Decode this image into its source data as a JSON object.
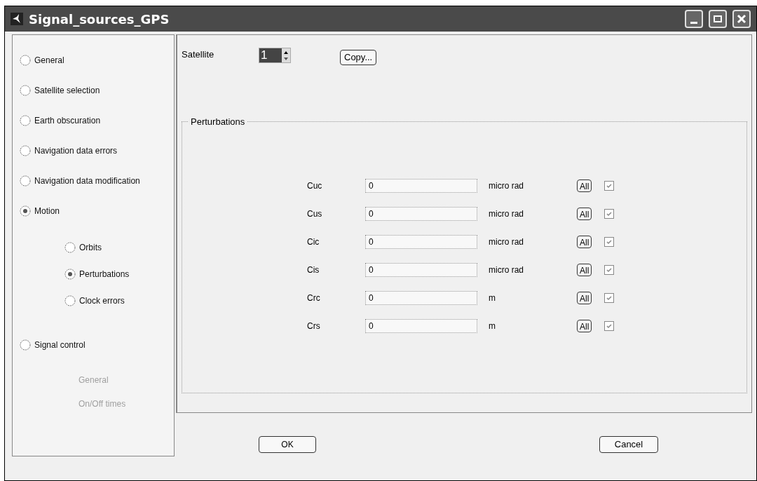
{
  "window": {
    "title": "Signal_sources_GPS"
  },
  "sidebar": {
    "items": [
      {
        "kind": "radio",
        "label": "General",
        "selected": false,
        "disabled": false
      },
      {
        "kind": "radio",
        "label": "Satellite selection",
        "selected": false,
        "disabled": false
      },
      {
        "kind": "radio",
        "label": "Earth obscuration",
        "selected": false,
        "disabled": false
      },
      {
        "kind": "radio",
        "label": "Navigation data errors",
        "selected": false,
        "disabled": false
      },
      {
        "kind": "radio",
        "label": "Navigation data modification",
        "selected": false,
        "disabled": false
      },
      {
        "kind": "radio",
        "label": "Motion",
        "selected": true,
        "disabled": false,
        "children": [
          {
            "kind": "radio",
            "label": "Orbits",
            "selected": false,
            "disabled": false
          },
          {
            "kind": "radio",
            "label": "Perturbations",
            "selected": true,
            "disabled": false
          },
          {
            "kind": "radio",
            "label": "Clock errors",
            "selected": false,
            "disabled": false
          }
        ]
      },
      {
        "kind": "radio",
        "label": "Signal control",
        "selected": false,
        "disabled": false,
        "children": [
          {
            "kind": "label",
            "label": "General",
            "disabled": true
          },
          {
            "kind": "label",
            "label": "On/Off times",
            "disabled": true
          }
        ]
      }
    ]
  },
  "satellite": {
    "label": "Satellite",
    "value": "1",
    "copy_button": "Copy..."
  },
  "perturbations": {
    "title": "Perturbations",
    "rows": [
      {
        "name": "Cuc",
        "value": "0",
        "unit": "micro rad",
        "button": "All",
        "checked": true
      },
      {
        "name": "Cus",
        "value": "0",
        "unit": "micro rad",
        "button": "All",
        "checked": true
      },
      {
        "name": "Cic",
        "value": "0",
        "unit": "micro rad",
        "button": "All",
        "checked": true
      },
      {
        "name": "Cis",
        "value": "0",
        "unit": "micro rad",
        "button": "All",
        "checked": true
      },
      {
        "name": "Crc",
        "value": "0",
        "unit": "m",
        "button": "All",
        "checked": true
      },
      {
        "name": "Crs",
        "value": "0",
        "unit": "m",
        "button": "All",
        "checked": true
      }
    ]
  },
  "buttons": {
    "ok": "OK",
    "cancel": "Cancel"
  }
}
